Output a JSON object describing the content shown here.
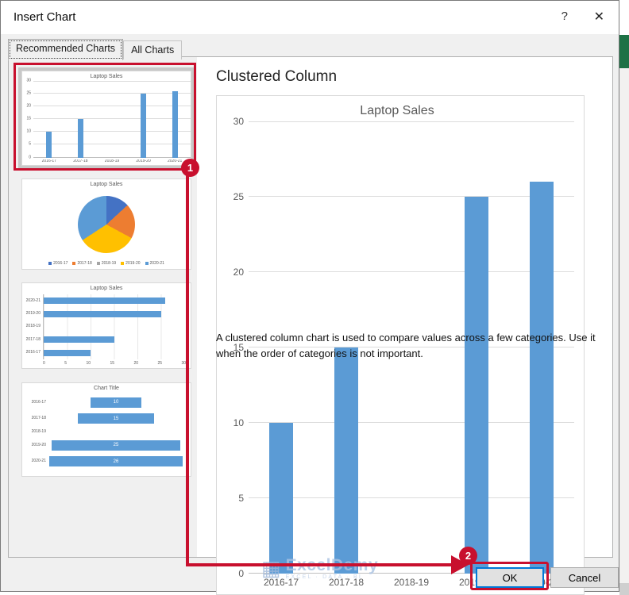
{
  "dialog": {
    "title": "Insert Chart",
    "help_label": "?",
    "close_label": "✕"
  },
  "colors": {
    "accent": "#0078d7",
    "bar_blue": "#5b9bd5",
    "excel_green": "#1e7145"
  },
  "tabs": [
    {
      "label": "Recommended Charts",
      "active": true
    },
    {
      "label": "All Charts",
      "active": false
    }
  ],
  "sidebar": {
    "thumbnails": [
      {
        "chart": "thumb-column",
        "selected": true
      },
      {
        "chart": "thumb-pie",
        "selected": false
      },
      {
        "chart": "thumb-bar",
        "selected": false
      },
      {
        "chart": "thumb-funnel",
        "selected": false
      }
    ]
  },
  "preview": {
    "heading": "Clustered Column",
    "description": "A clustered column chart is used to compare values across a few categories. Use it when the order of categories is not important."
  },
  "buttons": {
    "ok": "OK",
    "cancel": "Cancel"
  },
  "annotations": {
    "color": "#c8102e",
    "step1": "1",
    "step2": "2"
  },
  "watermark": {
    "icon": "▦",
    "name": "ExcelDemy",
    "tagline": "EXCEL · DATA · BI"
  },
  "chart_data": [
    {
      "id": "preview-column",
      "type": "bar",
      "variant": "clustered-column",
      "title": "Laptop Sales",
      "categories": [
        "2016-17",
        "2017-18",
        "2018-19",
        "2019-20",
        "2020-21"
      ],
      "values": [
        10,
        15,
        null,
        25,
        26
      ],
      "xlabel": "",
      "ylabel": "",
      "ylim": [
        0,
        30
      ],
      "yticks": [
        0,
        5,
        10,
        15,
        20,
        25,
        30
      ],
      "grid": true,
      "legend": false,
      "bar_color": "#5b9bd5"
    },
    {
      "id": "thumb-column",
      "type": "bar",
      "variant": "clustered-column",
      "title": "Laptop Sales",
      "categories": [
        "2016-17",
        "2017-18",
        "2018-19",
        "2019-20",
        "2020-21"
      ],
      "values": [
        10,
        15,
        null,
        25,
        26
      ],
      "ylim": [
        0,
        30
      ],
      "yticks": [
        0,
        5,
        10,
        15,
        20,
        25,
        30
      ],
      "grid": true,
      "legend": false,
      "bar_color": "#5b9bd5"
    },
    {
      "id": "thumb-pie",
      "type": "pie",
      "title": "Laptop Sales",
      "categories": [
        "2016-17",
        "2017-18",
        "2018-19",
        "2019-20",
        "2020-21"
      ],
      "values": [
        10,
        15,
        0,
        25,
        26
      ],
      "colors": [
        "#4472c4",
        "#ed7d31",
        "#a5a5a5",
        "#ffc000",
        "#5b9bd5"
      ],
      "legend_position": "bottom"
    },
    {
      "id": "thumb-bar",
      "type": "bar",
      "variant": "horizontal",
      "title": "Laptop Sales",
      "categories": [
        "2020-21",
        "2019-20",
        "2018-19",
        "2017-18",
        "2016-17"
      ],
      "values": [
        26,
        25,
        0,
        15,
        10
      ],
      "xlim": [
        0,
        30
      ],
      "xticks": [
        0,
        5,
        10,
        15,
        20,
        25,
        30
      ],
      "grid": true,
      "legend": false,
      "bar_color": "#5b9bd5"
    },
    {
      "id": "thumb-funnel",
      "type": "bar",
      "variant": "funnel",
      "title": "Chart Title",
      "categories": [
        "2016-17",
        "2017-18",
        "2018-19",
        "2019-20",
        "2020-21"
      ],
      "values": [
        10,
        15,
        null,
        25,
        26
      ],
      "data_labels": true,
      "legend": false,
      "bar_color": "#5b9bd5"
    }
  ]
}
